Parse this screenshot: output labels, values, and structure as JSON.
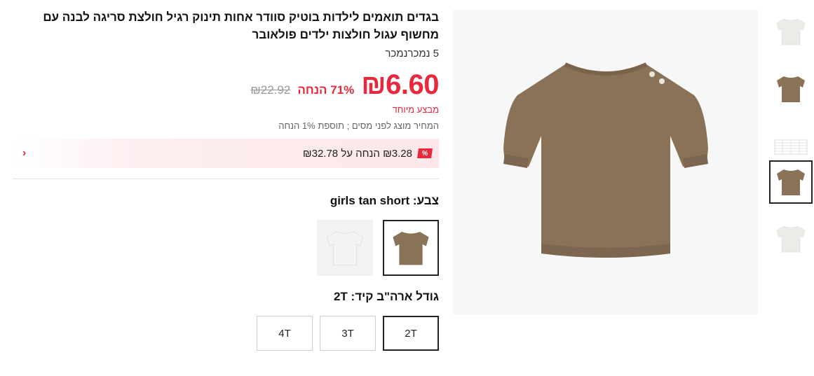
{
  "product": {
    "title": "בגדים תואמים לילדות בוטיק סוודר אחות תינוק רגיל חולצת סריגה לבנה עם מחשוף עגול חולצות ילדים פולאובר",
    "sold": "5 נמכרנמכר"
  },
  "pricing": {
    "price": "₪6.60",
    "discount": "71% הנחה",
    "original": "₪22.92",
    "promo_label": "מבצע מיוחד",
    "tax_note": "המחיר מוצג לפני מסים ; תוספת 1% הנחה"
  },
  "coupon": {
    "badge": "%",
    "text": "₪3.28 הנחה על ₪32.78",
    "chevron": "‹"
  },
  "color": {
    "label": "צבע:",
    "value": "girls tan short",
    "options": [
      {
        "name": "girls tan short",
        "color": "#8a7258",
        "selected": true
      },
      {
        "name": "white",
        "color": "#e9e9e7",
        "selected": false
      }
    ]
  },
  "size": {
    "label": "גודל ארה\"ב קיד:",
    "value": "2T",
    "options": [
      "2T",
      "3T",
      "4T"
    ],
    "selected": "2T"
  },
  "gallery": {
    "thumbnails": [
      {
        "kind": "sweater",
        "color": "#ebebe8",
        "selected": false
      },
      {
        "kind": "sweater",
        "color": "#8a7258",
        "selected": false
      },
      {
        "kind": "size-chart",
        "color": "#dddddd",
        "selected": false
      },
      {
        "kind": "sweater",
        "color": "#8a7258",
        "selected": true
      },
      {
        "kind": "sweater",
        "color": "#ebebe8",
        "selected": false
      }
    ],
    "main_color": "#8a7258"
  },
  "colors": {
    "accent": "#e8283c",
    "tan": "#8a7258",
    "white_item": "#ebebe8"
  }
}
